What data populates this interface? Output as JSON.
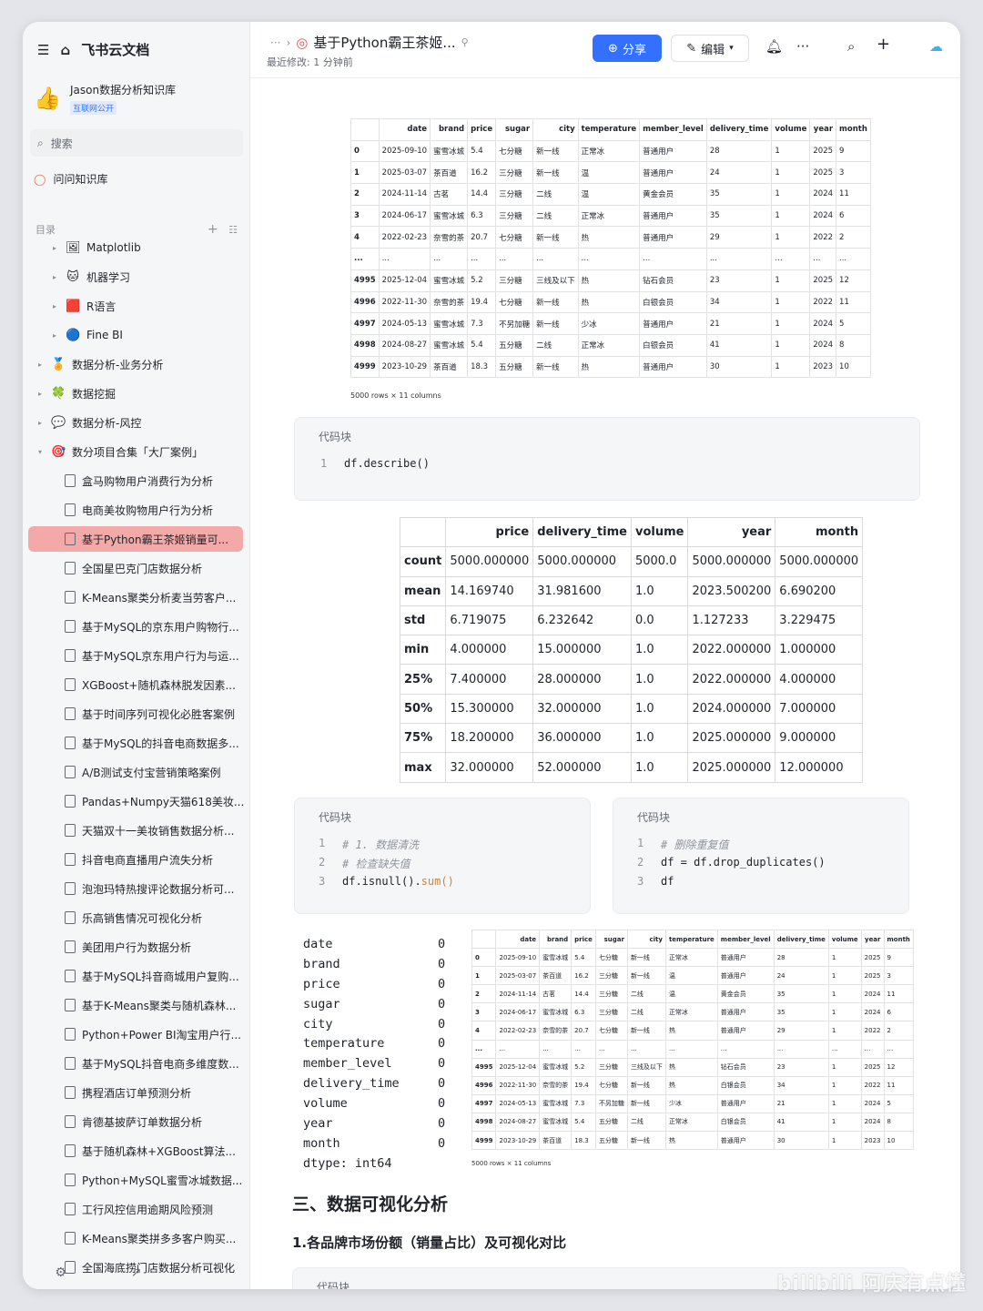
{
  "app": {
    "name": "飞书云文档"
  },
  "knowledge_base": {
    "name": "Jason数据分析知识库",
    "tag": "互联网公开"
  },
  "sidebar": {
    "search_label": "搜索",
    "qa_label": "问问知识库",
    "toc_label": "目录",
    "items": [
      {
        "label": "Matplotlib",
        "icon": "🖼",
        "level": 1,
        "arrow": "▸"
      },
      {
        "label": "机器学习",
        "icon": "🐱",
        "level": 1,
        "arrow": "▸"
      },
      {
        "label": "R语言",
        "icon": "🟥",
        "level": 1,
        "arrow": "▸"
      },
      {
        "label": "Fine BI",
        "icon": "🔵",
        "level": 1,
        "arrow": "▸"
      },
      {
        "label": "数据分析-业务分析",
        "icon": "🏅",
        "level": 0,
        "arrow": "▸"
      },
      {
        "label": "数据挖掘",
        "icon": "🍀",
        "level": 0,
        "arrow": "▸"
      },
      {
        "label": "数据分析-风控",
        "icon": "💬",
        "level": 0,
        "arrow": "▸"
      },
      {
        "label": "数分项目合集「大厂案例」",
        "icon": "🎯",
        "level": 0,
        "arrow": "▾"
      },
      {
        "label": "盒马购物用户消费行为分析",
        "level": 2
      },
      {
        "label": "电商美妆购物用户行为分析",
        "level": 2
      },
      {
        "label": "基于Python霸王茶姬销量可...",
        "level": 2,
        "active": true
      },
      {
        "label": "全国星巴克门店数据分析",
        "level": 2
      },
      {
        "label": "K-Means聚类分析麦当劳客户...",
        "level": 2
      },
      {
        "label": "基于MySQL的京东用户购物行...",
        "level": 2
      },
      {
        "label": "基于MySQL京东用户行为与运...",
        "level": 2
      },
      {
        "label": "XGBoost+随机森林脱发因素...",
        "level": 2
      },
      {
        "label": "基于时间序列可视化必胜客案例",
        "level": 2
      },
      {
        "label": "基于MySQL的抖音电商数据多...",
        "level": 2
      },
      {
        "label": "A/B测试支付宝营销策略案例",
        "level": 2
      },
      {
        "label": "Pandas+Numpy天猫618美妆...",
        "level": 2
      },
      {
        "label": "天猫双十一美妆销售数据分析...",
        "level": 2
      },
      {
        "label": "抖音电商直播用户流失分析",
        "level": 2
      },
      {
        "label": "泡泡玛特热搜评论数据分析可...",
        "level": 2
      },
      {
        "label": "乐高销售情况可视化分析",
        "level": 2
      },
      {
        "label": "美团用户行为数据分析",
        "level": 2
      },
      {
        "label": "基于MySQL抖音商城用户复购...",
        "level": 2
      },
      {
        "label": "基于K-Means聚类与随机森林...",
        "level": 2
      },
      {
        "label": "Python+Power BI淘宝用户行...",
        "level": 2
      },
      {
        "label": "基于MySQL抖音电商多维度数...",
        "level": 2
      },
      {
        "label": "携程酒店订单预测分析",
        "level": 2
      },
      {
        "label": "肯德基披萨订单数据分析",
        "level": 2
      },
      {
        "label": "基于随机森林+XGBoost算法...",
        "level": 2
      },
      {
        "label": "Python+MySQL蜜雪冰城数据...",
        "level": 2
      },
      {
        "label": "工行风控信用逾期风险预测",
        "level": 2
      },
      {
        "label": "K-Means聚类拼多多客户购买...",
        "level": 2
      },
      {
        "label": "全国海底捞门店数据分析可视化",
        "level": 2
      }
    ]
  },
  "header": {
    "title": "基于Python霸王茶姬...",
    "modified": "最近修改: 1 分钟前",
    "share_label": "分享",
    "edit_label": "编辑"
  },
  "data_table": {
    "columns": [
      "",
      "date",
      "brand",
      "price",
      "sugar",
      "city",
      "temperature",
      "member_level",
      "delivery_time",
      "volume",
      "year",
      "month"
    ],
    "rows": [
      [
        "0",
        "2025-09-10",
        "蜜雪冰城",
        "5.4",
        "七分糖",
        "新一线",
        "正常冰",
        "普通用户",
        "28",
        "1",
        "2025",
        "9"
      ],
      [
        "1",
        "2025-03-07",
        "茶百道",
        "16.2",
        "三分糖",
        "新一线",
        "温",
        "普通用户",
        "24",
        "1",
        "2025",
        "3"
      ],
      [
        "2",
        "2024-11-14",
        "古茗",
        "14.4",
        "三分糖",
        "二线",
        "温",
        "黄金会员",
        "35",
        "1",
        "2024",
        "11"
      ],
      [
        "3",
        "2024-06-17",
        "蜜雪冰城",
        "6.3",
        "三分糖",
        "二线",
        "正常冰",
        "普通用户",
        "35",
        "1",
        "2024",
        "6"
      ],
      [
        "4",
        "2022-02-23",
        "奈雪的茶",
        "20.7",
        "七分糖",
        "新一线",
        "热",
        "普通用户",
        "29",
        "1",
        "2022",
        "2"
      ],
      [
        "...",
        "...",
        "...",
        "...",
        "...",
        "...",
        "...",
        "...",
        "...",
        "...",
        "...",
        "..."
      ],
      [
        "4995",
        "2025-12-04",
        "蜜雪冰城",
        "5.2",
        "三分糖",
        "三线及以下",
        "热",
        "钻石会员",
        "23",
        "1",
        "2025",
        "12"
      ],
      [
        "4996",
        "2022-11-30",
        "奈雪的茶",
        "19.4",
        "七分糖",
        "新一线",
        "热",
        "白银会员",
        "34",
        "1",
        "2022",
        "11"
      ],
      [
        "4997",
        "2024-05-13",
        "蜜雪冰城",
        "7.3",
        "不另加糖",
        "新一线",
        "少冰",
        "普通用户",
        "21",
        "1",
        "2024",
        "5"
      ],
      [
        "4998",
        "2024-08-27",
        "蜜雪冰城",
        "5.4",
        "五分糖",
        "二线",
        "正常冰",
        "白银会员",
        "41",
        "1",
        "2024",
        "8"
      ],
      [
        "4999",
        "2023-10-29",
        "茶百道",
        "18.3",
        "五分糖",
        "新一线",
        "热",
        "普通用户",
        "30",
        "1",
        "2023",
        "10"
      ]
    ],
    "rows_info": "5000 rows × 11 columns"
  },
  "code_blocks": [
    {
      "title": "代码块",
      "lines": [
        {
          "n": "1",
          "code": "df.describe()"
        }
      ]
    },
    {
      "title": "代码块",
      "lines": [
        {
          "n": "1",
          "comment": "# 1. 数据清洗"
        },
        {
          "n": "2",
          "comment": "# 检查缺失值"
        },
        {
          "n": "3",
          "code": "df.isnull().",
          "fn": "sum()"
        }
      ]
    },
    {
      "title": "代码块",
      "lines": [
        {
          "n": "1",
          "comment": "# 删除重复值"
        },
        {
          "n": "2",
          "code": "df = df.drop_duplicates()"
        },
        {
          "n": "3",
          "code": "df"
        }
      ]
    },
    {
      "title": "代码块"
    }
  ],
  "describe_table": {
    "columns": [
      "",
      "price",
      "delivery_time",
      "volume",
      "year",
      "month"
    ],
    "rows": [
      [
        "count",
        "5000.000000",
        "5000.000000",
        "5000.0",
        "5000.000000",
        "5000.000000"
      ],
      [
        "mean",
        "14.169740",
        "31.981600",
        "1.0",
        "2023.500200",
        "6.690200"
      ],
      [
        "std",
        "6.719075",
        "6.232642",
        "0.0",
        "1.127233",
        "3.229475"
      ],
      [
        "min",
        "4.000000",
        "15.000000",
        "1.0",
        "2022.000000",
        "1.000000"
      ],
      [
        "25%",
        "7.400000",
        "28.000000",
        "1.0",
        "2022.000000",
        "4.000000"
      ],
      [
        "50%",
        "15.300000",
        "32.000000",
        "1.0",
        "2024.000000",
        "7.000000"
      ],
      [
        "75%",
        "18.200000",
        "36.000000",
        "1.0",
        "2025.000000",
        "9.000000"
      ],
      [
        "max",
        "32.000000",
        "52.000000",
        "1.0",
        "2025.000000",
        "12.000000"
      ]
    ]
  },
  "null_counts": [
    [
      "date",
      "0"
    ],
    [
      "brand",
      "0"
    ],
    [
      "price",
      "0"
    ],
    [
      "sugar",
      "0"
    ],
    [
      "city",
      "0"
    ],
    [
      "temperature",
      "0"
    ],
    [
      "member_level",
      "0"
    ],
    [
      "delivery_time",
      "0"
    ],
    [
      "volume",
      "0"
    ],
    [
      "year",
      "0"
    ],
    [
      "month",
      "0"
    ],
    [
      "dtype: int64",
      ""
    ]
  ],
  "section": {
    "heading": "三、数据可视化分析",
    "subheading": "1.各品牌市场份额（销量占比）及可视化对比"
  },
  "watermark": "bilibili 阿庆有点懂",
  "colors": {
    "accent": "#3370ff",
    "active_item": "#f4a9a9",
    "code_bg": "#f5f6f7"
  }
}
